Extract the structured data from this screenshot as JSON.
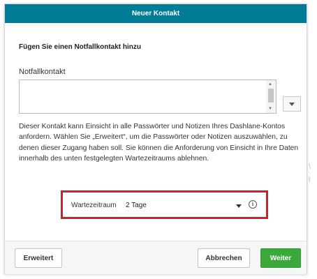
{
  "dialog": {
    "title": "Neuer Kontakt",
    "heading": "Fügen Sie einen Notfallkontakt hinzu",
    "field_label": "Notfallkontakt",
    "contact_value": "",
    "description": "Dieser Kontakt kann Einsicht in alle Passwörter und Notizen Ihres Dashlane-Kontos anfordern. Wählen Sie „Erweitert“, um die Passwörter oder Notizen auszuwählen, zu denen dieser Zugang haben soll. Sie können die Anforderung von Einsicht in Ihre Daten innerhalb des unten festgelegten Wartezeitraums ablehnen.",
    "wait_period": {
      "label": "Wartezeitraum",
      "value": "2 Tage",
      "info_icon": "info-icon"
    },
    "buttons": {
      "advanced": "Erweitert",
      "cancel": "Abbrechen",
      "next": "Weiter"
    }
  },
  "colors": {
    "titlebar": "#007c97",
    "highlight_border": "#c1272d",
    "primary_button": "#3aa83a"
  }
}
